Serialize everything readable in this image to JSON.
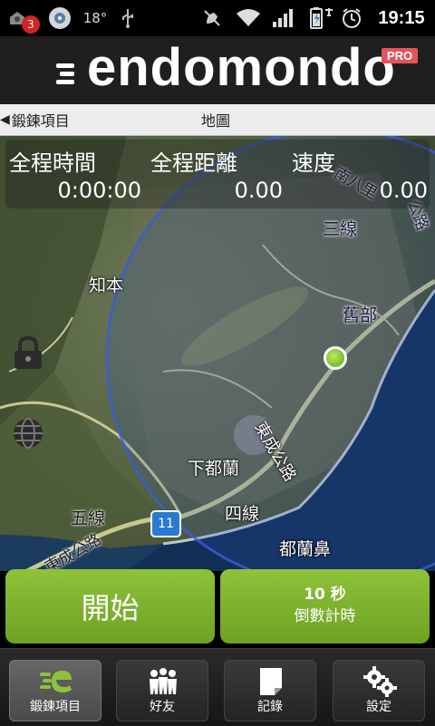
{
  "status_bar": {
    "notification_count": "3",
    "temperature": "18°",
    "time": "19:15"
  },
  "header": {
    "logo": "endomondo",
    "badge": "PRO"
  },
  "nav": {
    "back_label": "鍛鍊項目",
    "title": "地圖"
  },
  "stats": [
    {
      "label": "全程時間",
      "value": "0:00:00"
    },
    {
      "label": "全程距離",
      "value": "0.00"
    },
    {
      "label": "速度",
      "value": "0.00"
    }
  ],
  "map": {
    "place_labels": [
      "知本",
      "三線",
      "舊部",
      "下都蘭",
      "四線",
      "五線",
      "都蘭鼻",
      "南八里",
      "公路",
      "東成公路",
      "東成公路"
    ],
    "route_shield": "11",
    "location_color": "#7bc43a",
    "radius_color": "#3a5cd6"
  },
  "actions": {
    "start_label": "開始",
    "countdown_value": "10 秒",
    "countdown_label": "倒數計時"
  },
  "tabs": [
    {
      "label": "鍛鍊項目",
      "icon": "endomondo-runner-icon"
    },
    {
      "label": "好友",
      "icon": "friends-icon"
    },
    {
      "label": "記錄",
      "icon": "history-icon"
    },
    {
      "label": "設定",
      "icon": "settings-gears-icon"
    }
  ],
  "colors": {
    "accent_green": "#7bb32e",
    "pro_red": "#e3545a"
  }
}
